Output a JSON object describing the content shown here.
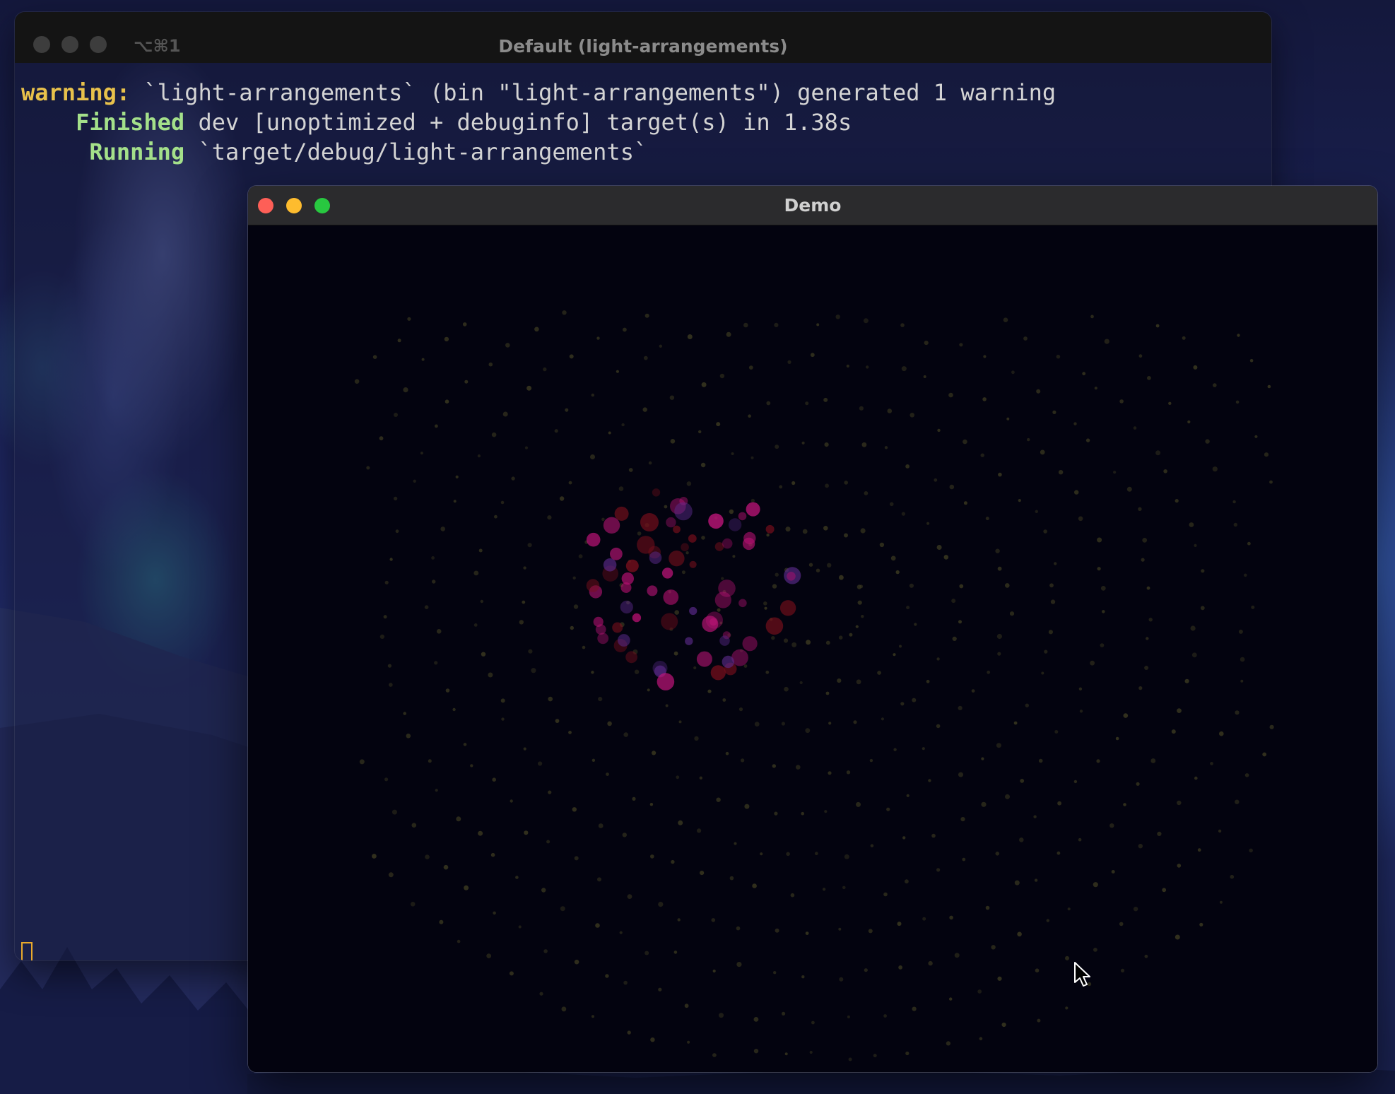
{
  "terminal": {
    "title": "Default (light-arrangements)",
    "shortcut": "⌥⌘1",
    "lines": [
      {
        "tag": "warning:",
        "text": " `light-arrangements` (bin \"light-arrangements\") generated 1 warning"
      },
      {
        "tag": "    Finished",
        "text": " dev [unoptimized + debuginfo] target(s) in 1.38s"
      },
      {
        "tag": "     Running",
        "text": " `target/debug/light-arrangements`"
      }
    ],
    "colors": {
      "warning": "#e8c14b",
      "ok": "#a4e08a",
      "text": "#d4d4d4",
      "cursor": "#e8a92c"
    }
  },
  "demo": {
    "title": "Demo",
    "background": "#03030f",
    "controls": {
      "close": "close-button",
      "minimize": "minimize-button",
      "maximize": "maximize-button"
    },
    "scene": {
      "description_icon": "particle-sphere",
      "accent_colors": [
        "#b3116f",
        "#7a0f1c",
        "#c0157a",
        "#5a2a8a"
      ],
      "dot_color": "#3a3820"
    }
  }
}
